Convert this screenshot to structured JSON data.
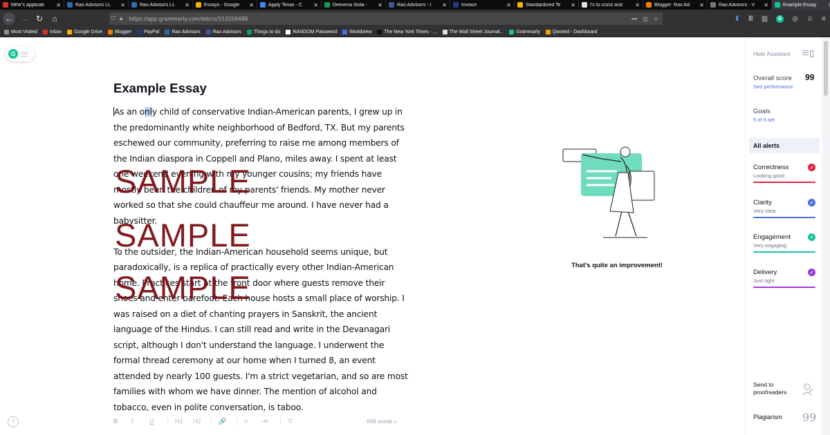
{
  "browser": {
    "tabs": [
      {
        "label": "Mihir's applicati",
        "icon": "gmail-icon",
        "color": "#d93025",
        "active": false
      },
      {
        "label": "Rao Advisors LL",
        "icon": "rao-icon",
        "color": "#2b6cb0",
        "active": false
      },
      {
        "label": "Rao Advisors LL",
        "icon": "rao-icon",
        "color": "#2b6cb0",
        "active": false
      },
      {
        "label": "Essays - Google",
        "icon": "google-drive-icon",
        "color": "#f4b400",
        "active": false
      },
      {
        "label": "Apply Texas - C",
        "icon": "docs-icon",
        "color": "#4285f4",
        "active": false
      },
      {
        "label": "Deevena Sista -",
        "icon": "sheets-icon",
        "color": "#0f9d58",
        "active": false
      },
      {
        "label": "Rao Advisors - I",
        "icon": "facebook-icon",
        "color": "#3b5998",
        "active": false
      },
      {
        "label": "Invoice",
        "icon": "paypal-icon",
        "color": "#253b80",
        "active": false
      },
      {
        "label": "Standardized Te",
        "icon": "chart-icon",
        "color": "#f4b400",
        "active": false
      },
      {
        "label": "I's to cross and",
        "icon": "grammarly-icon",
        "color": "#e0e0e0",
        "active": false
      },
      {
        "label": "Blogger: Rao Ad",
        "icon": "blogger-icon",
        "color": "#f57c00",
        "active": false
      },
      {
        "label": "Rao Advisors - V",
        "icon": "rao-icon",
        "color": "#777777",
        "active": false
      },
      {
        "label": "Example Essay",
        "icon": "grammarly-icon",
        "color": "#15c39a",
        "active": true
      }
    ],
    "close_glyph": "✕",
    "url": "https://app.grammarly.com/ddocs/553209486",
    "bookmarks": [
      {
        "label": "Most Visited",
        "icon": "gear-icon",
        "color": "#8e8e93"
      },
      {
        "label": "Inbox",
        "icon": "gmail-icon",
        "color": "#d93025"
      },
      {
        "label": "Google Drive",
        "icon": "google-drive-icon",
        "color": "#f4b400"
      },
      {
        "label": "Blogger",
        "icon": "blogger-icon",
        "color": "#f57c00"
      },
      {
        "label": "PayPal",
        "icon": "paypal-icon",
        "color": "#253b80"
      },
      {
        "label": "Rao Advisors",
        "icon": "rao-icon",
        "color": "#2b6cb0"
      },
      {
        "label": "Rao Advisors",
        "icon": "facebook-icon",
        "color": "#3b5998"
      },
      {
        "label": "Things to do",
        "icon": "sheets-icon",
        "color": "#0f9d58"
      },
      {
        "label": "RANDOM Password",
        "icon": "random-icon",
        "color": "#ffffff"
      },
      {
        "label": "Worldview",
        "icon": "worldview-icon",
        "color": "#4a6ee0"
      },
      {
        "label": "The New York Times - ...",
        "icon": "nyt-icon",
        "color": "#111111"
      },
      {
        "label": "The Wall Street Journal...",
        "icon": "wsj-icon",
        "color": "#dddddd"
      },
      {
        "label": "Grammarly",
        "icon": "grammarly-icon",
        "color": "#15c39a"
      },
      {
        "label": "Qwoted - Dashboard",
        "icon": "qwoted-icon",
        "color": "#f4a300"
      }
    ]
  },
  "document": {
    "title": "Example Essay",
    "paragraphs": [
      {
        "pre": "As an o",
        "highlight": "nl",
        "post": "y child of conservative Indian-American parents, I grew up in the predominantly white neighborhood of Bedford, TX. But my parents eschewed our community, preferring to raise me among members of the Indian diaspora in Coppell and Plano, miles away. I spent at least one weekend evening with my younger cousins; my friends have mostly been the children of my parents' friends. My mother never worked so that she could chauffeur me around. I have never had a babysitter."
      },
      {
        "pre": "",
        "highlight": "",
        "post": "To the outsider, the Indian-American household seems unique, but paradoxically, is a replica of practically every other Indian-American home. Practices start at the front door where guests remove their shoes and enter barefoot. Each house hosts a small place of worship. I was raised on a diet of chanting prayers in Sanskrit, the ancient language of the Hindus. I can still read and write in the Devanagari script, although I don't understand the language. I underwent the formal thread ceremony at our home when I turned 8, an event attended by nearly 100 guests. I'm a strict vegetarian, and so are most families with whom we have dinner. The mention of alcohol and tobacco, even in polite conversation, is taboo."
      }
    ],
    "watermark": "SAMPLE",
    "word_count": "698 words",
    "word_count_arrow": "»",
    "format_buttons": [
      "B",
      "I",
      "U",
      "H1",
      "H2",
      "🔗",
      "≡",
      "≔",
      "T̸"
    ]
  },
  "illustration": {
    "caption": "That's quite an improvement!",
    "accent": "#6fdcbd"
  },
  "assistant": {
    "hide_label": "Hide Assistant",
    "overall_score_label": "Overall score",
    "overall_score": "99",
    "see_performance": "See performance",
    "goals_label": "Goals",
    "goals_value": "5 of 5 set",
    "all_alerts": "All alerts",
    "categories": [
      {
        "name": "Correctness",
        "desc": "Looking good",
        "color": "#e5233a"
      },
      {
        "name": "Clarity",
        "desc": "Very clear",
        "color": "#4a6ee0"
      },
      {
        "name": "Engagement",
        "desc": "Very engaging",
        "color": "#15c39a"
      },
      {
        "name": "Delivery",
        "desc": "Just right",
        "color": "#9c38d6"
      }
    ],
    "check_glyph": "✓",
    "send_label_1": "Send to",
    "send_label_2": "proofreaders",
    "plagiarism": "Plagiarism",
    "plagiarism_glyph": "99",
    "help_glyph": "?"
  }
}
